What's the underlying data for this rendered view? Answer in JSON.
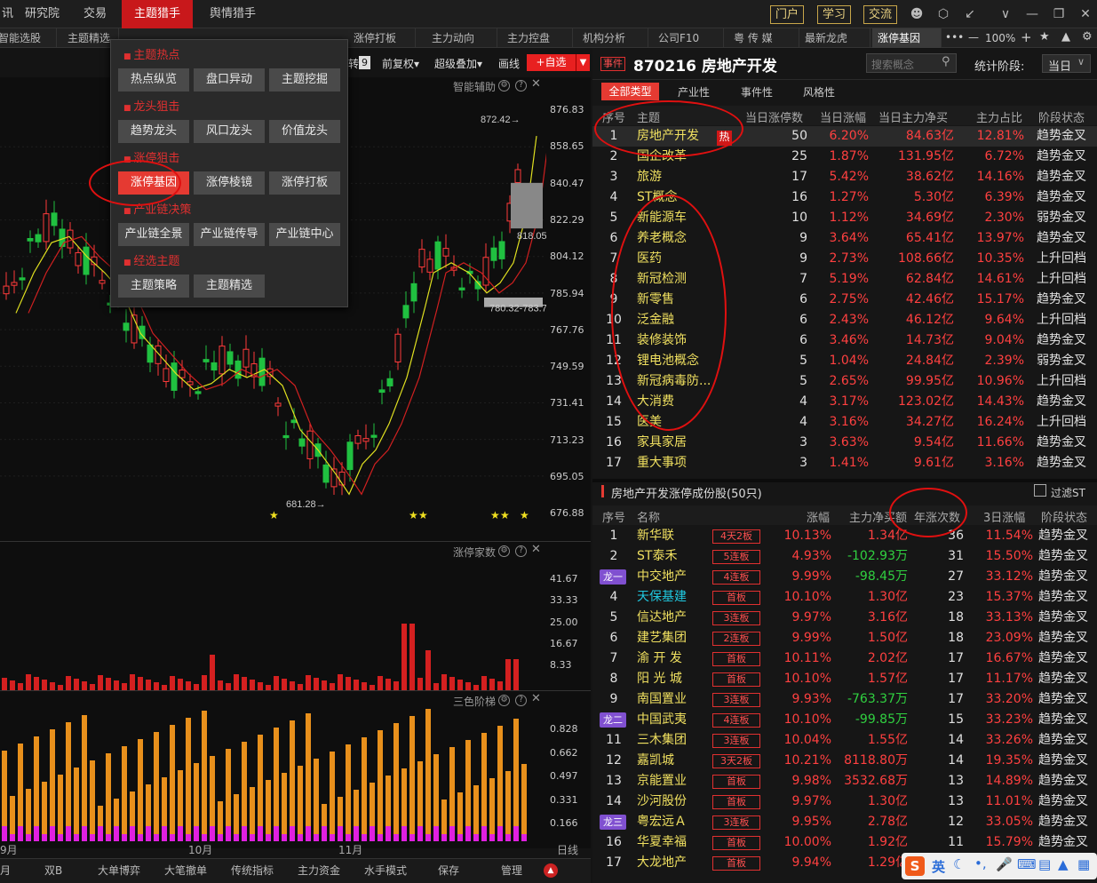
{
  "menu": {
    "items": [
      "讯",
      "研究院",
      "交易",
      "主题猎手",
      "舆情猎手"
    ],
    "active": "主题猎手",
    "right_buttons": [
      "门户",
      "学习",
      "交流"
    ],
    "window_icons": [
      "user-icon",
      "hexagon-icon",
      "shrink-icon",
      "chevron-down-icon",
      "minimize-icon",
      "restore-icon",
      "close-icon"
    ]
  },
  "tabs": [
    "智能选股",
    "主题精选",
    "",
    "",
    "涨停打板",
    "主力动向",
    "主力控盘",
    "机构分析",
    "公司F10",
    "粤 传 媒",
    "最新龙虎",
    "涨停基因"
  ],
  "tab_active": "涨停基因",
  "tab_tools": {
    "more": "•••",
    "minus": "—",
    "zoom": "100%",
    "plus": "+",
    "star": "★"
  },
  "toolbar": {
    "badge": "9",
    "labels": [
      "前复权▾",
      "超级叠加▾",
      "画线"
    ],
    "add_self": "+自选",
    "prefix": "转"
  },
  "chart": {
    "panel_title": "智能辅助",
    "y_labels": [
      "876.83",
      "858.65",
      "840.47",
      "822.29",
      "804.12",
      "785.94",
      "767.76",
      "749.59",
      "731.41",
      "713.23",
      "695.05",
      "676.88"
    ],
    "annotations": {
      "high": "872.42",
      "low": "681.28",
      "band1": "818.05-840.70",
      "band2": "780.32-783.72"
    },
    "x_labels": [
      "9月",
      "10月",
      "11月"
    ],
    "vol_title": "涨停家数",
    "vol_y": [
      "41.67",
      "33.33",
      "25.00",
      "16.67",
      "8.33"
    ],
    "ladder_title": "三色阶梯",
    "ladder_y": [
      "0.828",
      "0.662",
      "0.497",
      "0.331",
      "0.166"
    ],
    "period": "日线"
  },
  "popup": {
    "sections": [
      {
        "title": "主题热点",
        "buttons": [
          "热点纵览",
          "盘口异动",
          "主题挖掘"
        ]
      },
      {
        "title": "龙头狙击",
        "buttons": [
          "趋势龙头",
          "风口龙头",
          "价值龙头"
        ]
      },
      {
        "title": "涨停狙击",
        "buttons": [
          "涨停基因",
          "涨停棱镜",
          "涨停打板"
        ]
      },
      {
        "title": "产业链决策",
        "buttons": [
          "产业链全景",
          "产业链传导",
          "产业链中心"
        ]
      },
      {
        "title": "经选主题",
        "buttons": [
          "主题策略",
          "主题精选"
        ]
      }
    ],
    "selected": "涨停基因"
  },
  "bottom": {
    "items": [
      "双B",
      "大单博弈",
      "大笔撤单",
      "传统指标",
      "主力资金",
      "水手模式",
      "保存",
      "管理"
    ],
    "first": "月"
  },
  "header": {
    "event_tag": "事件",
    "code_title": "870216 房地产开发",
    "search_placeholder": "搜索概念",
    "stat_label": "统计阶段:",
    "stat_value": "当日"
  },
  "filter_tabs": [
    "全部类型",
    "产业性",
    "事件性",
    "风格性"
  ],
  "themes": {
    "columns": [
      "序号",
      "主题",
      "当日涨停数",
      "当日涨幅",
      "当日主力净买",
      "主力占比",
      "阶段状态"
    ],
    "hot_badge": "热",
    "rows": [
      [
        "1",
        "房地产开发",
        "50",
        "6.20%",
        "84.63亿",
        "12.81%",
        "趋势金叉"
      ],
      [
        "2",
        "国企改革",
        "25",
        "1.87%",
        "131.95亿",
        "6.72%",
        "趋势金叉"
      ],
      [
        "3",
        "旅游",
        "17",
        "5.42%",
        "38.62亿",
        "14.16%",
        "趋势金叉"
      ],
      [
        "4",
        "ST概念",
        "16",
        "1.27%",
        "5.30亿",
        "6.39%",
        "趋势金叉"
      ],
      [
        "5",
        "新能源车",
        "10",
        "1.12%",
        "34.69亿",
        "2.30%",
        "弱势金叉"
      ],
      [
        "6",
        "养老概念",
        "9",
        "3.64%",
        "65.41亿",
        "13.97%",
        "趋势金叉"
      ],
      [
        "7",
        "医药",
        "9",
        "2.73%",
        "108.66亿",
        "10.35%",
        "上升回档"
      ],
      [
        "8",
        "新冠检测",
        "7",
        "5.19%",
        "62.84亿",
        "14.61%",
        "上升回档"
      ],
      [
        "9",
        "新零售",
        "6",
        "2.75%",
        "42.46亿",
        "15.17%",
        "趋势金叉"
      ],
      [
        "10",
        "泛金融",
        "6",
        "2.43%",
        "46.12亿",
        "9.64%",
        "上升回档"
      ],
      [
        "11",
        "装修装饰",
        "6",
        "3.46%",
        "14.73亿",
        "9.04%",
        "趋势金叉"
      ],
      [
        "12",
        "锂电池概念",
        "5",
        "1.04%",
        "24.84亿",
        "2.39%",
        "弱势金叉"
      ],
      [
        "13",
        "新冠病毒防...",
        "5",
        "2.65%",
        "99.95亿",
        "10.96%",
        "上升回档"
      ],
      [
        "14",
        "大消费",
        "4",
        "3.17%",
        "123.02亿",
        "14.43%",
        "趋势金叉"
      ],
      [
        "15",
        "医美",
        "4",
        "3.16%",
        "34.27亿",
        "16.24%",
        "上升回档"
      ],
      [
        "16",
        "家具家居",
        "3",
        "3.63%",
        "9.54亿",
        "11.66%",
        "趋势金叉"
      ],
      [
        "17",
        "重大事项",
        "3",
        "1.41%",
        "9.61亿",
        "3.16%",
        "趋势金叉"
      ]
    ]
  },
  "stocks": {
    "title": "房地产开发涨停成份股(50只)",
    "filter_label": "过滤ST",
    "columns": [
      "序号",
      "名称",
      "涨幅",
      "主力净买额",
      "年涨次数",
      "3日涨幅",
      "阶段状态"
    ],
    "rows": [
      [
        "1",
        "新华联",
        "4天2板",
        "10.13%",
        "1.34亿",
        "36",
        "11.54%",
        "趋势金叉",
        ""
      ],
      [
        "2",
        "ST泰禾",
        "5连板",
        "4.93%",
        "-102.93万",
        "31",
        "15.50%",
        "趋势金叉",
        ""
      ],
      [
        "3",
        "中交地产",
        "4连板",
        "9.99%",
        "-98.45万",
        "27",
        "33.12%",
        "趋势金叉",
        "龙一"
      ],
      [
        "4",
        "天保基建",
        "首板",
        "10.10%",
        "1.30亿",
        "23",
        "15.37%",
        "趋势金叉",
        ""
      ],
      [
        "5",
        "信达地产",
        "3连板",
        "9.97%",
        "3.16亿",
        "18",
        "33.13%",
        "趋势金叉",
        ""
      ],
      [
        "6",
        "建艺集团",
        "2连板",
        "9.99%",
        "1.50亿",
        "18",
        "23.09%",
        "趋势金叉",
        ""
      ],
      [
        "7",
        "渝 开 发",
        "首板",
        "10.11%",
        "2.02亿",
        "17",
        "16.67%",
        "趋势金叉",
        ""
      ],
      [
        "8",
        "阳 光 城",
        "首板",
        "10.10%",
        "1.57亿",
        "17",
        "11.17%",
        "趋势金叉",
        ""
      ],
      [
        "9",
        "南国置业",
        "3连板",
        "9.93%",
        "-763.37万",
        "17",
        "33.20%",
        "趋势金叉",
        ""
      ],
      [
        "10",
        "中国武夷",
        "4连板",
        "10.10%",
        "-99.85万",
        "15",
        "33.23%",
        "趋势金叉",
        "龙二"
      ],
      [
        "11",
        "三木集团",
        "3连板",
        "10.04%",
        "1.55亿",
        "14",
        "33.26%",
        "趋势金叉",
        ""
      ],
      [
        "12",
        "嘉凯城",
        "3天2板",
        "10.21%",
        "8118.80万",
        "14",
        "19.35%",
        "趋势金叉",
        ""
      ],
      [
        "13",
        "京能置业",
        "首板",
        "9.98%",
        "3532.68万",
        "13",
        "14.89%",
        "趋势金叉",
        ""
      ],
      [
        "14",
        "沙河股份",
        "首板",
        "9.97%",
        "1.30亿",
        "13",
        "11.01%",
        "趋势金叉",
        ""
      ],
      [
        "15",
        "粤宏远Ａ",
        "3连板",
        "9.95%",
        "2.78亿",
        "12",
        "33.05%",
        "趋势金叉",
        "龙三"
      ],
      [
        "16",
        "华夏幸福",
        "首板",
        "10.00%",
        "1.92亿",
        "11",
        "15.79%",
        "趋势金叉",
        ""
      ],
      [
        "17",
        "大龙地产",
        "首板",
        "9.94%",
        "1.29亿",
        "",
        "",
        "趋势金叉",
        ""
      ]
    ]
  },
  "ime": {
    "lang": "英",
    "icons": [
      "moon-icon",
      "punctuation-icon",
      "mic-icon",
      "keyboard-icon",
      "toolbox-icon",
      "shirt-icon",
      "grid-icon"
    ]
  },
  "colors": {
    "accent": "#c8181b",
    "up": "#ff4040",
    "down": "#30d040",
    "theme_name": "#f0e060"
  }
}
